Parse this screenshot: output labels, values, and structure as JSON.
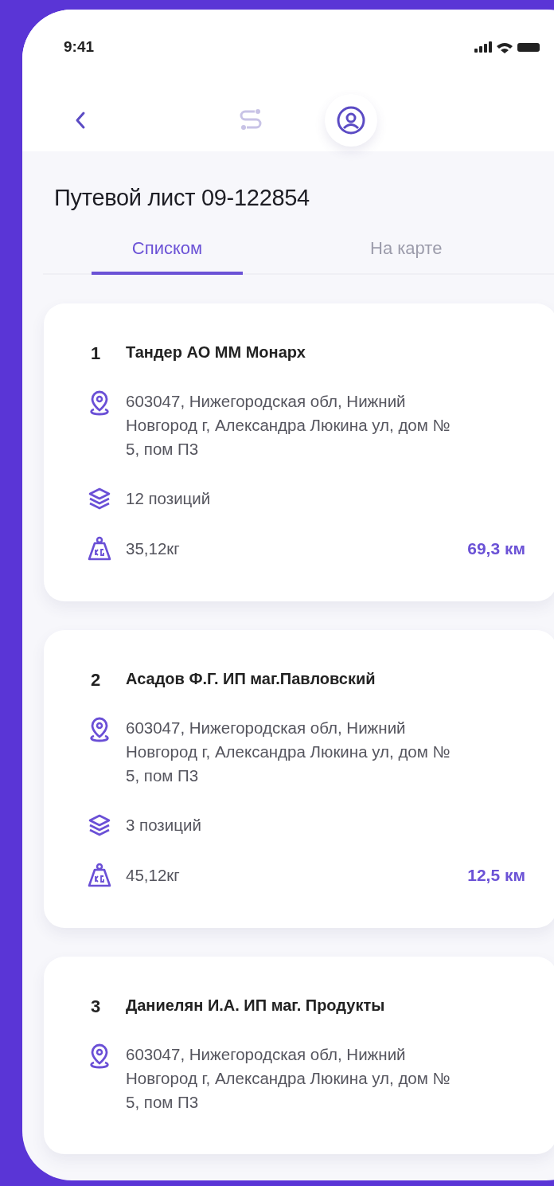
{
  "status_bar": {
    "time": "9:41"
  },
  "title": "Путевой лист 09-122854",
  "tabs": [
    {
      "label": "Списком",
      "selected": true
    },
    {
      "label": "На карте",
      "selected": false
    }
  ],
  "stops": [
    {
      "number": "1",
      "name": "Тандер АО ММ Монарх",
      "address": "603047, Нижегородская обл, Нижний Новгород г, Александра Люкина ул, дом № 5, пом П3",
      "positions": "12 позиций",
      "weight": "35,12кг",
      "distance": "69,3 км"
    },
    {
      "number": "2",
      "name": "Асадов Ф.Г. ИП маг.Павловский",
      "address": "603047, Нижегородская обл, Нижний Новгород г, Александра Люкина ул, дом № 5, пом П3",
      "positions": "3 позиций",
      "weight": "45,12кг",
      "distance": "12,5 км"
    },
    {
      "number": "3",
      "name": "Даниелян И.А. ИП маг. Продукты",
      "address": "603047, Нижегородская обл, Нижний Новгород г, Александра Люкина ул, дом № 5, пом П3"
    }
  ]
}
